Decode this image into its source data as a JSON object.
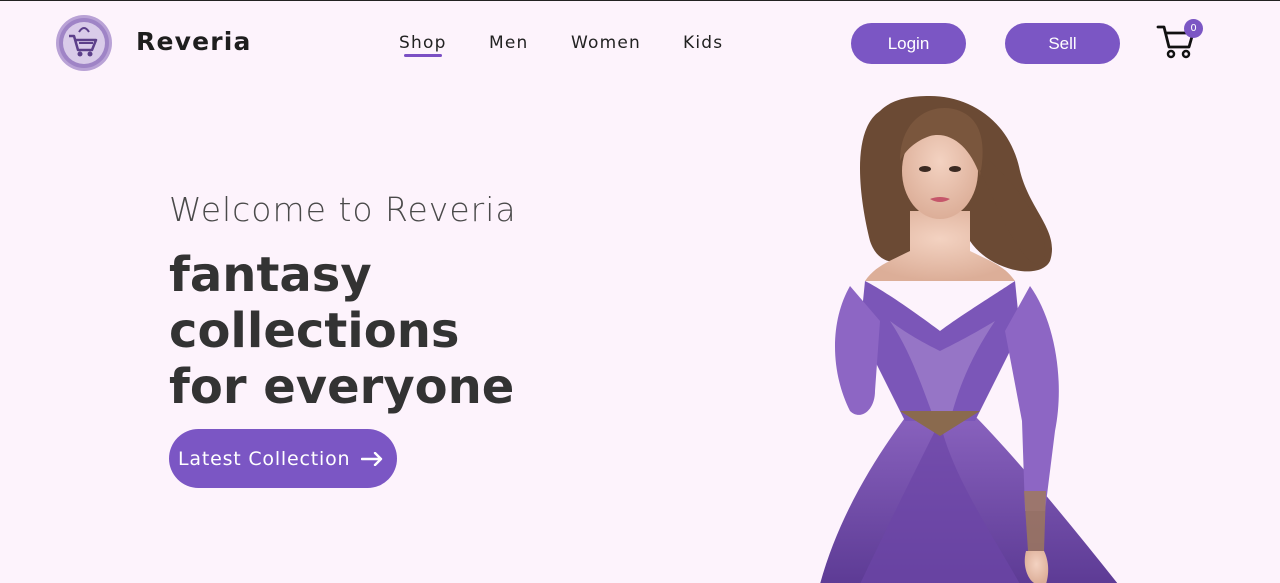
{
  "brand": {
    "name": "Reveria",
    "logo_icon": "shopping-basket-logo-icon"
  },
  "nav": {
    "items": [
      {
        "label": "Shop",
        "active": true
      },
      {
        "label": "Men",
        "active": false
      },
      {
        "label": "Women",
        "active": false
      },
      {
        "label": "Kids",
        "active": false
      }
    ]
  },
  "actions": {
    "login_label": "Login",
    "sell_label": "Sell",
    "cart_icon": "cart-icon",
    "cart_count": "0"
  },
  "hero": {
    "welcome": "Welcome to Reveria",
    "headline_lines": [
      "fantasy",
      "collections",
      "for everyone"
    ],
    "cta_label": "Latest Collection",
    "cta_icon": "arrow-right-icon",
    "image_icon": "model-in-purple-gown-illustration"
  },
  "colors": {
    "accent": "#7b56c4",
    "background": "#fdf3fc",
    "text": "#333333"
  }
}
